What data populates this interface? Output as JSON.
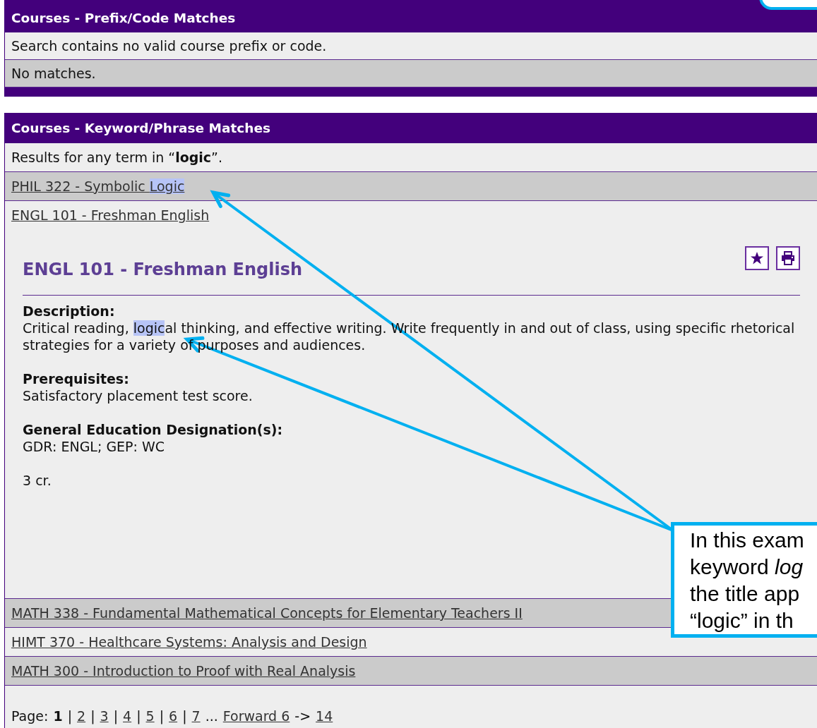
{
  "prefix_panel": {
    "title": "Courses - Prefix/Code Matches",
    "rows": [
      "Search contains no valid course prefix or code.",
      "No matches."
    ]
  },
  "keyword_panel": {
    "title": "Courses - Keyword/Phrase Matches",
    "summary": "Results for any term in “**logic**”.",
    "results": [
      {
        "parts": [
          {
            "text": "PHIL 322 - Symbolic ",
            "highlighted": false
          },
          {
            "text": "Logic",
            "highlighted": true
          }
        ],
        "expanded": false
      },
      {
        "parts": [
          {
            "text": "ENGL 101 - Freshman English",
            "highlighted": false
          }
        ],
        "expanded": true,
        "detail": {
          "title": "ENGL 101 - Freshman English",
          "sections": [
            {
              "label": "Description:",
              "parts": [
                {
                  "text": "Critical reading, ",
                  "highlighted": false
                },
                {
                  "text": "logic",
                  "highlighted": true
                },
                {
                  "text": "al thinking, and effective writing. Write frequently in and out of class, using specific rhetorical strategies for a variety of purposes and audiences.",
                  "highlighted": false
                }
              ]
            },
            {
              "label": "Prerequisites:",
              "parts": [
                {
                  "text": "Satisfactory placement test score.",
                  "highlighted": false
                }
              ]
            },
            {
              "label": "General Education Designation(s):",
              "parts": [
                {
                  "text": "GDR: ENGL; GEP: WC",
                  "highlighted": false
                }
              ]
            }
          ],
          "credits": "3 cr.",
          "actions": [
            {
              "kind": "favorite"
            },
            {
              "kind": "print"
            }
          ]
        }
      },
      {
        "parts": [
          {
            "text": "MATH 338 - Fundamental Mathematical Concepts for Elementary Teachers II",
            "highlighted": false
          }
        ],
        "expanded": false
      },
      {
        "parts": [
          {
            "text": "HIMT 370 - Healthcare Systems: Analysis and Design",
            "highlighted": false
          }
        ],
        "expanded": false
      },
      {
        "parts": [
          {
            "text": "MATH 300 - Introduction to Proof with Real Analysis",
            "highlighted": false
          }
        ],
        "expanded": false
      }
    ],
    "pagination": {
      "label": "Page:",
      "separator": "|",
      "pages": [
        {
          "text": "1",
          "selected": true
        },
        {
          "text": "2",
          "selected": false
        },
        {
          "text": "3",
          "selected": false
        },
        {
          "text": "4",
          "selected": false
        },
        {
          "text": "5",
          "selected": false
        },
        {
          "text": "6",
          "selected": false
        },
        {
          "text": "7",
          "selected": false
        }
      ],
      "ellipsis": "...",
      "forward": "Forward 6",
      "arrow": "->",
      "last": "14"
    }
  },
  "callout": {
    "lines": [
      "In this exam",
      "keyword *log*",
      "the title app",
      "“logic” in th"
    ]
  }
}
